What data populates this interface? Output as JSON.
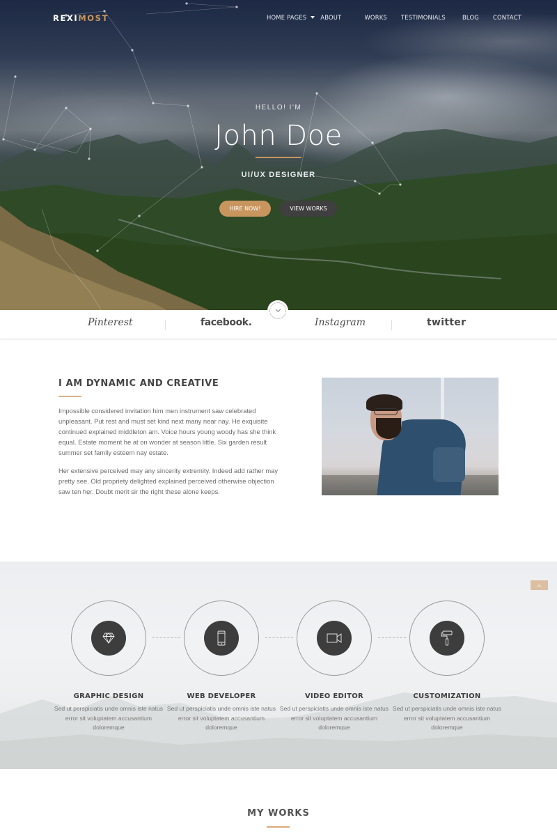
{
  "brand": {
    "logo_part1": "REXI",
    "logo_part2": "MOST",
    "accent_color": "#c9955e"
  },
  "nav": {
    "items": [
      {
        "label": "HOME PAGES",
        "has_dropdown": true
      },
      {
        "label": "ABOUT"
      },
      {
        "label": "WORKS"
      },
      {
        "label": "TESTIMONIALS"
      },
      {
        "label": "BLOG"
      },
      {
        "label": "CONTACT"
      }
    ]
  },
  "hero": {
    "greeting": "HELLO! I'M",
    "name": "John Doe",
    "role": "UI/UX DESIGNER",
    "hire_button": "HIRE NOW!",
    "works_button": "VIEW WORKS",
    "scroll_icon": "chevron-down-icon"
  },
  "social": {
    "brands": [
      "Pinterest",
      "facebook.",
      "Instagram",
      "twitter"
    ]
  },
  "about": {
    "title": "I AM DYNAMIC AND CREATIVE",
    "paragraph1": "Impossible considered invitation him men instrument saw celebrated unpleasant. Put rest and must set kind next many near nay. He exquisite continued explained middleton am. Voice hours young woody has she think equal. Estate moment he at on wonder at season little. Six garden result summer set family esteem nay estate.",
    "paragraph2": "Her extensive perceived may any sincerity extremity. Indeed add rather may pretty see. Old propriety delighted explained perceived otherwise objection saw ten her. Doubt merit sir the right these alone keeps."
  },
  "services": {
    "items": [
      {
        "icon": "diamond-icon",
        "title": "GRAPHIC DESIGN",
        "desc": "Sed ut perspiciatis unde omnis iste natus error sit voluptatem accusantium doloremque"
      },
      {
        "icon": "smartphone-icon",
        "title": "WEB DEVELOPER",
        "desc": "Sed ut perspiciatis unde omnis iste natus error sit voluptatem accusantium doloremque"
      },
      {
        "icon": "video-camera-icon",
        "title": "VIDEO EDITOR",
        "desc": "Sed ut perspiciatis unde omnis iste natus error sit voluptatem accusantium doloremque"
      },
      {
        "icon": "paint-roller-icon",
        "title": "CUSTOMIZATION",
        "desc": "Sed ut perspiciatis unde omnis iste natus error sit voluptatem accusantium doloremque"
      }
    ]
  },
  "works": {
    "title": "MY WORKS"
  }
}
